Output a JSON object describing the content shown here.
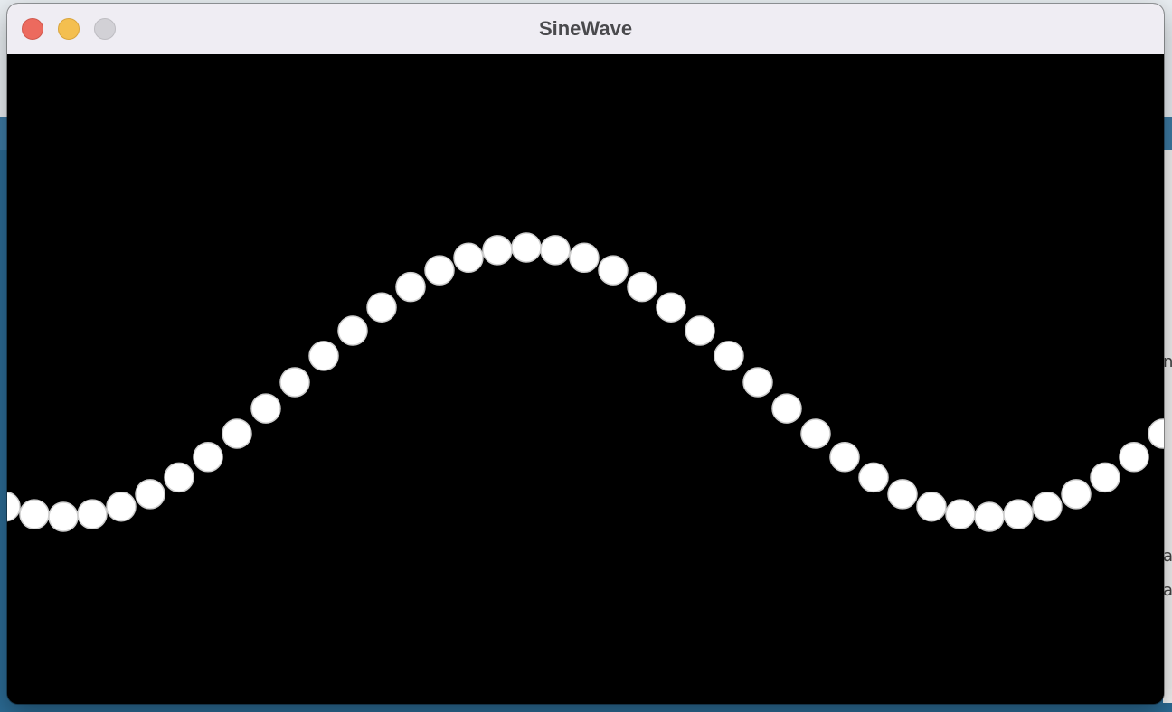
{
  "window": {
    "title": "SineWave",
    "controls": {
      "close_icon": "close-icon",
      "minimize_icon": "minimize-icon",
      "zoom_icon": "zoom-icon"
    },
    "colors": {
      "close": "#ec6a5e",
      "minimize": "#f4bf4f",
      "zoom": "#d2d1d6"
    }
  },
  "canvas": {
    "background": "#000000",
    "dot_color": "#ffffff",
    "dot_stroke": "#cfcfcf"
  },
  "background_fragments": {
    "right_edge_glyphs": [
      "n",
      "a",
      "a"
    ]
  }
}
